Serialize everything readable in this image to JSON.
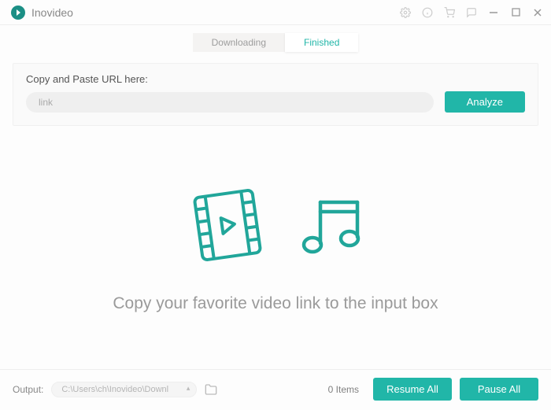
{
  "app": {
    "name": "Inovideo"
  },
  "tabs": {
    "downloading": "Downloading",
    "finished": "Finished"
  },
  "url_panel": {
    "label": "Copy and Paste URL here:",
    "placeholder": "link",
    "analyze": "Analyze"
  },
  "empty": {
    "message": "Copy your favorite video link to the input box"
  },
  "footer": {
    "output_label": "Output:",
    "output_path": "C:\\Users\\ch\\Inovideo\\Downl",
    "items": "0 Items",
    "resume": "Resume All",
    "pause": "Pause All"
  },
  "colors": {
    "accent": "#21b6a8"
  }
}
